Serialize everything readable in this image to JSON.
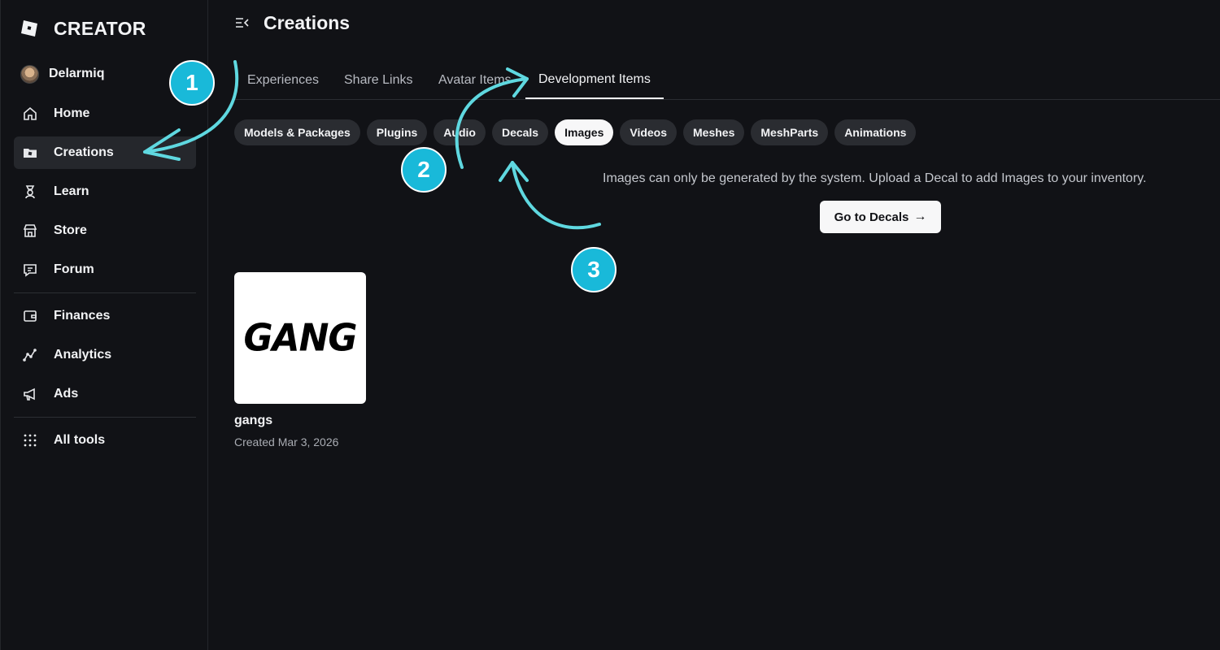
{
  "brand": {
    "name": "CREATOR",
    "logo_icon": "roblox-logo-icon"
  },
  "user": {
    "name": "Delarmiq"
  },
  "sidebar": {
    "items": [
      {
        "label": "Home",
        "icon": "home-icon"
      },
      {
        "label": "Creations",
        "icon": "creations-folder-icon",
        "active": true
      },
      {
        "label": "Learn",
        "icon": "learn-icon"
      },
      {
        "label": "Store",
        "icon": "store-icon"
      },
      {
        "label": "Forum",
        "icon": "forum-icon"
      },
      {
        "label": "Finances",
        "icon": "wallet-icon"
      },
      {
        "label": "Analytics",
        "icon": "analytics-icon"
      },
      {
        "label": "Ads",
        "icon": "megaphone-icon"
      },
      {
        "label": "All tools",
        "icon": "grid-icon"
      }
    ]
  },
  "header": {
    "title": "Creations"
  },
  "tabs": [
    {
      "label": "Experiences"
    },
    {
      "label": "Share Links"
    },
    {
      "label": "Avatar Items"
    },
    {
      "label": "Development Items",
      "active": true
    }
  ],
  "filters": [
    {
      "label": "Models & Packages"
    },
    {
      "label": "Plugins"
    },
    {
      "label": "Audio"
    },
    {
      "label": "Decals"
    },
    {
      "label": "Images",
      "active": true
    },
    {
      "label": "Videos"
    },
    {
      "label": "Meshes"
    },
    {
      "label": "MeshParts"
    },
    {
      "label": "Animations"
    }
  ],
  "notice": {
    "text": "Images can only be generated by the system. Upload a Decal to add Images to your inventory.",
    "button_label": "Go to Decals",
    "button_icon": "arrow-right-icon"
  },
  "items": [
    {
      "thumbnail_text": "GANG",
      "name": "gangs",
      "created": "Created Mar 3, 2026"
    }
  ],
  "annotations": {
    "badges": [
      "1",
      "2",
      "3"
    ],
    "color": "#19b9d9",
    "arrow_color": "#5fd8e0"
  },
  "colors": {
    "background": "#111216",
    "active_nav": "#25272c",
    "chip": "#2a2c31",
    "chip_active": "#f7f7f8"
  }
}
